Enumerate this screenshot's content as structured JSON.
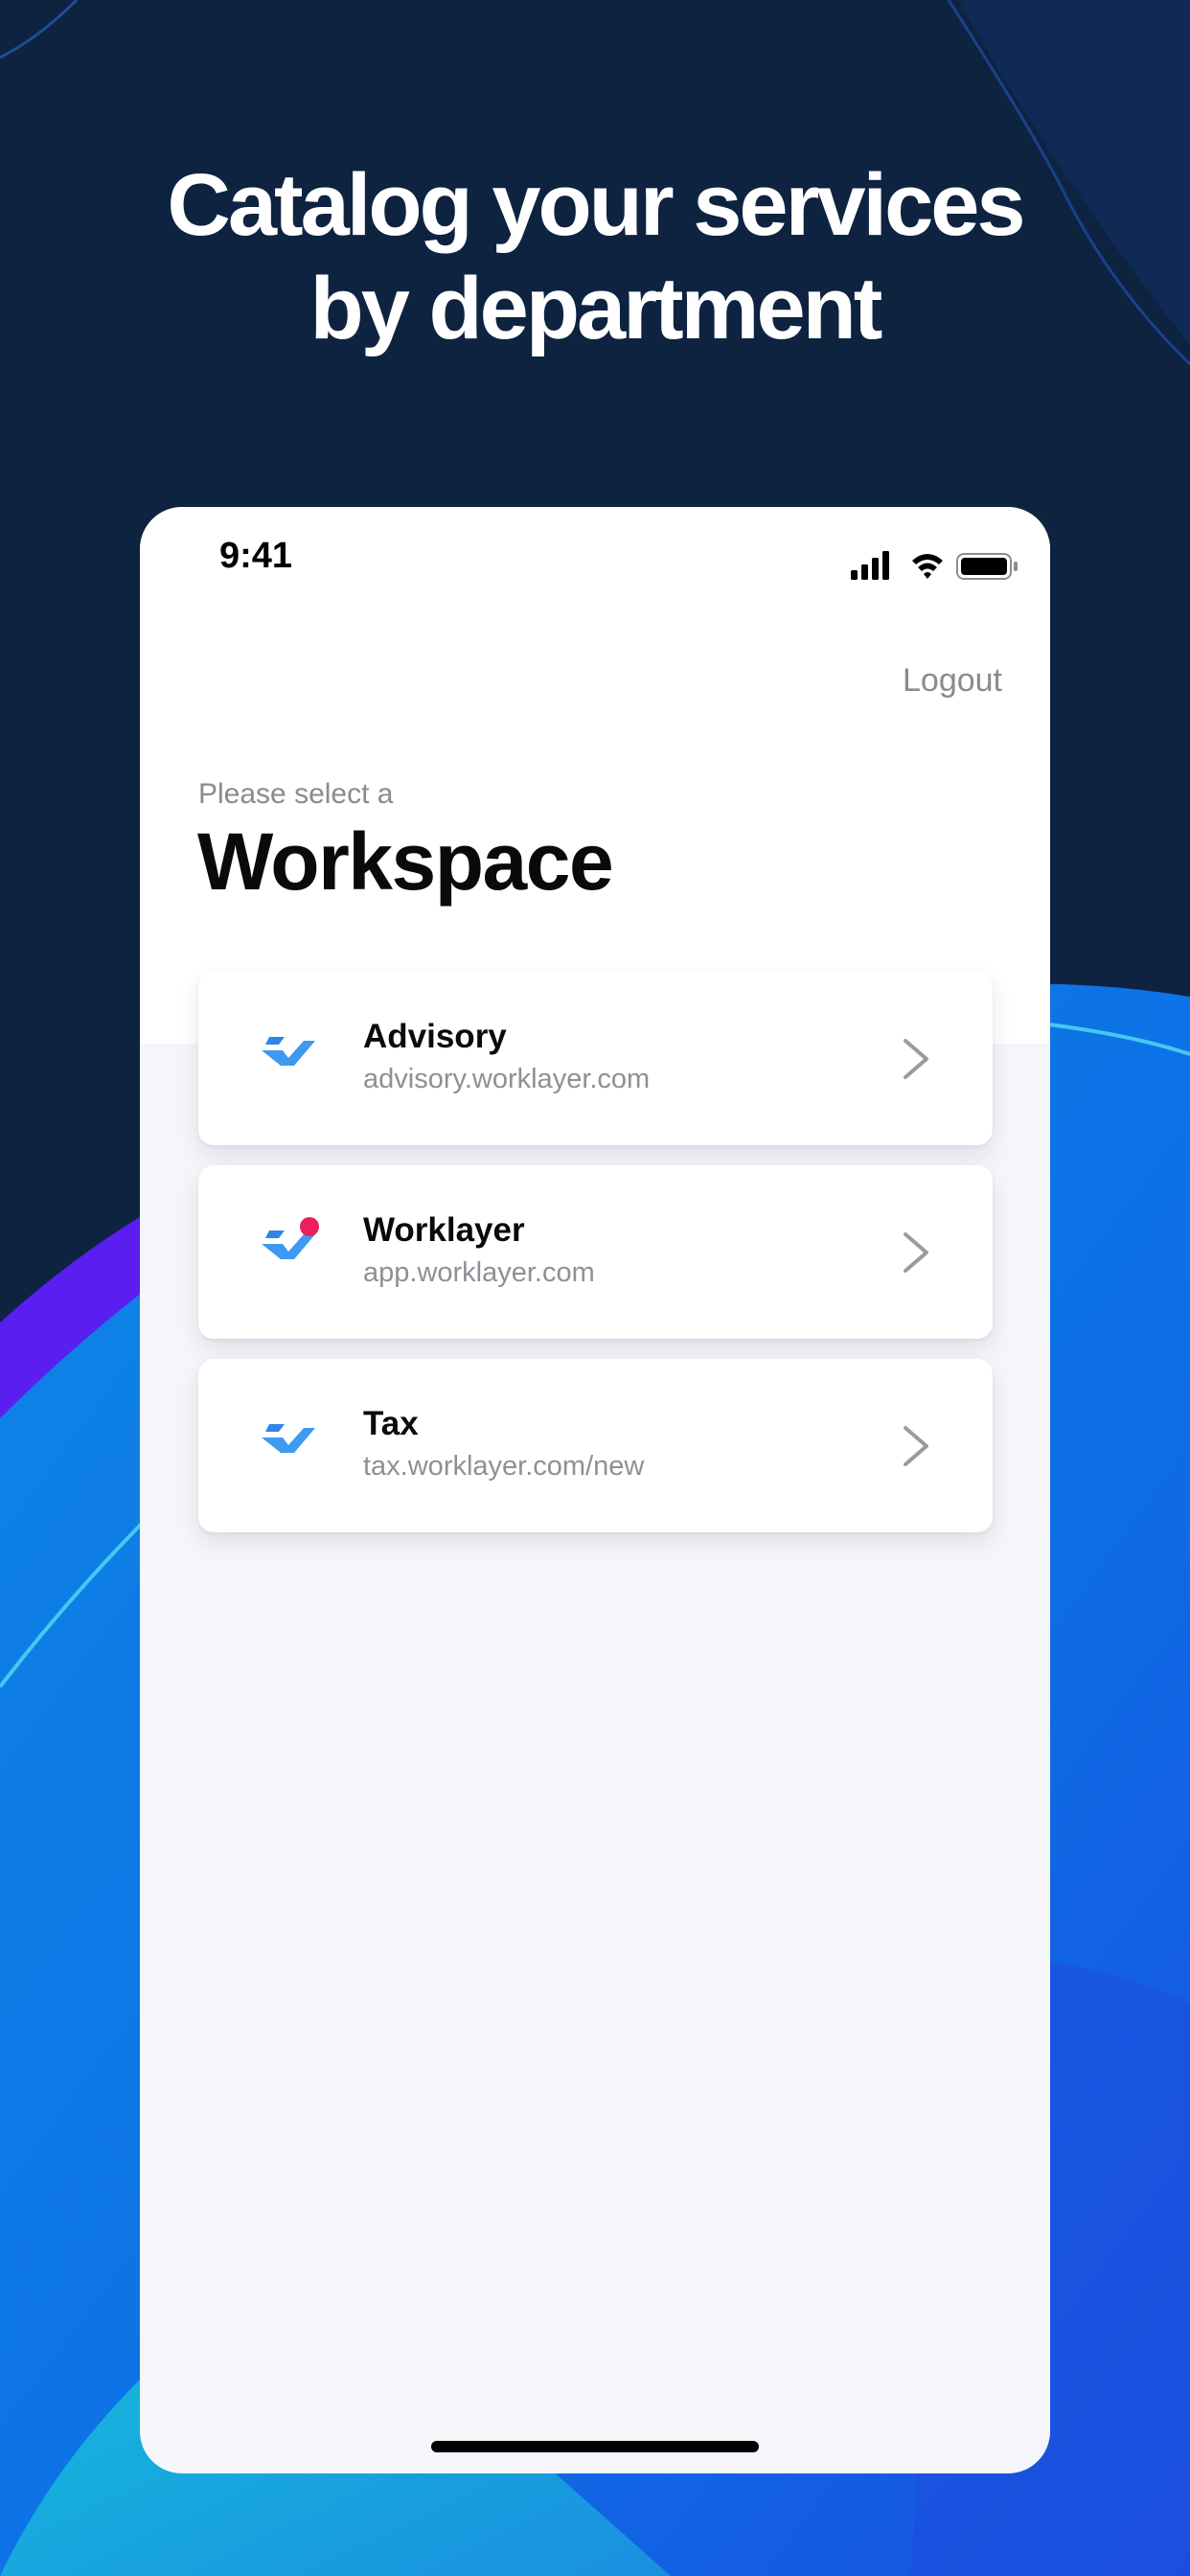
{
  "headline": {
    "line1": "Catalog your services",
    "line2": "by department"
  },
  "status_bar": {
    "time": "9:41",
    "icons": [
      "signal-icon",
      "wifi-icon",
      "battery-icon"
    ]
  },
  "header": {
    "logout_label": "Logout",
    "subtitle": "Please select a",
    "title": "Workspace"
  },
  "workspaces": [
    {
      "name": "Advisory",
      "url": "advisory.worklayer.com",
      "icon": "worklayer-logo-icon",
      "badge": false
    },
    {
      "name": "Worklayer",
      "url": "app.worklayer.com",
      "icon": "worklayer-logo-icon",
      "badge": true
    },
    {
      "name": "Tax",
      "url": "tax.worklayer.com/new",
      "icon": "worklayer-logo-icon",
      "badge": false
    }
  ],
  "colors": {
    "background_dark": "#0d2340",
    "wave_blue": "#0e7fe0",
    "wave_purple": "#5a1ef0",
    "wave_cyan": "#14b6de",
    "logo_blue": "#3d9af0",
    "badge_red": "#ea1f5c"
  }
}
